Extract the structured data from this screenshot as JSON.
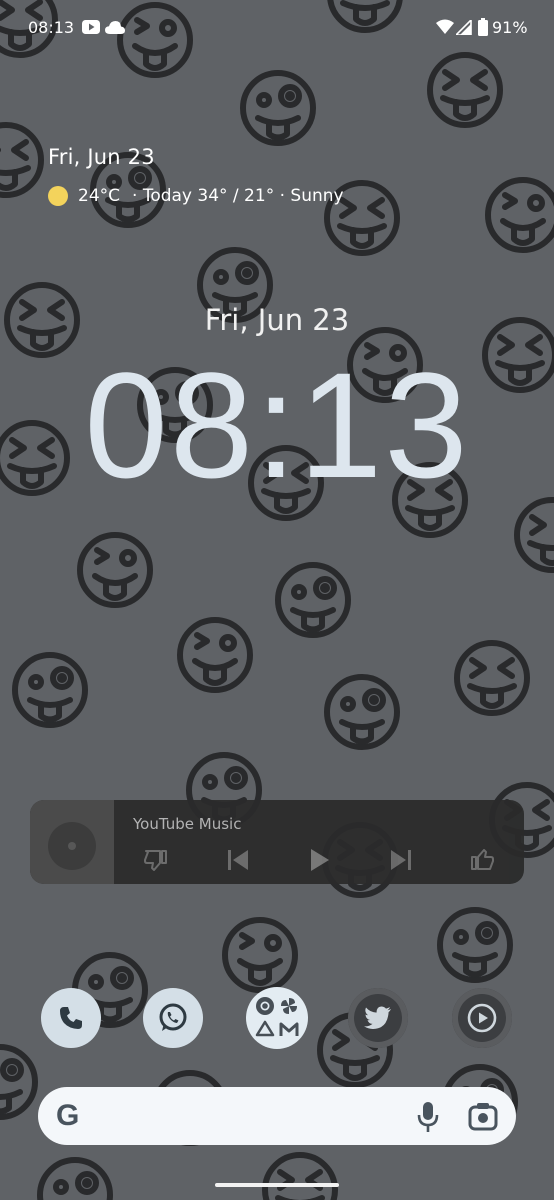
{
  "status_bar": {
    "time": "08:13",
    "battery": "91%",
    "icons": [
      "youtube-icon",
      "cloud-icon",
      "wifi-icon",
      "signal-icon",
      "battery-icon"
    ]
  },
  "glance": {
    "date": "Fri, Jun 23",
    "temperature": "24°C",
    "forecast": "· Today 34° / 21° · Sunny",
    "weather_icon": "sun-icon"
  },
  "clock": {
    "date": "Fri, Jun 23",
    "time": "08:13"
  },
  "media": {
    "app_name": "YouTube Music",
    "controls": [
      "thumbs-down-icon",
      "previous-icon",
      "play-icon",
      "next-icon",
      "thumbs-up-icon"
    ]
  },
  "dock": [
    "phone-icon",
    "whatsapp-icon",
    "app-folder",
    "twitter-icon",
    "youtube-music-icon"
  ],
  "search": {
    "logo": "G",
    "icons": [
      "mic-icon",
      "lens-icon"
    ]
  },
  "colors": {
    "background": "#5f6266",
    "clock": "#dde6ee",
    "dock_light": "#d4dfe7",
    "media_card": "#2b2b2b",
    "sun": "#f3d35c",
    "search_bar": "#f4f7fa"
  }
}
